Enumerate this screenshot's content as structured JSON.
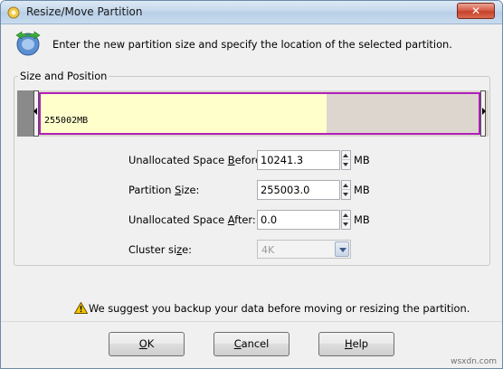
{
  "window": {
    "title": "Resize/Move Partition",
    "close_label": "✕"
  },
  "header": {
    "instruction": "Enter the new partition size and specify the location of the selected partition."
  },
  "group": {
    "legend": "Size and Position",
    "partition_label": "255002MB"
  },
  "fields": {
    "unalloc_before": {
      "label_pre": "Unallocated Space ",
      "label_key": "B",
      "label_post": "efore:",
      "value": "10241.3",
      "unit": "MB"
    },
    "partition_size": {
      "label_pre": "Partition ",
      "label_key": "S",
      "label_post": "ize:",
      "value": "255003.0",
      "unit": "MB"
    },
    "unalloc_after": {
      "label_pre": "Unallocated Space ",
      "label_key": "A",
      "label_post": "fter:",
      "value": "0.0",
      "unit": "MB"
    },
    "cluster_size": {
      "label_pre": "Cluster si",
      "label_key": "z",
      "label_post": "e:",
      "value": "4K"
    }
  },
  "warning": {
    "text": "We suggest you backup your data before moving or resizing the partition."
  },
  "buttons": {
    "ok": {
      "key": "O",
      "rest": "K"
    },
    "cancel": {
      "key": "C",
      "rest": "ancel"
    },
    "help": {
      "key": "H",
      "rest": "elp"
    }
  },
  "watermark": "wsxdn.com",
  "icons": {
    "app": "partition-icon",
    "header": "resize-partition-icon",
    "warning": "warning-icon"
  }
}
